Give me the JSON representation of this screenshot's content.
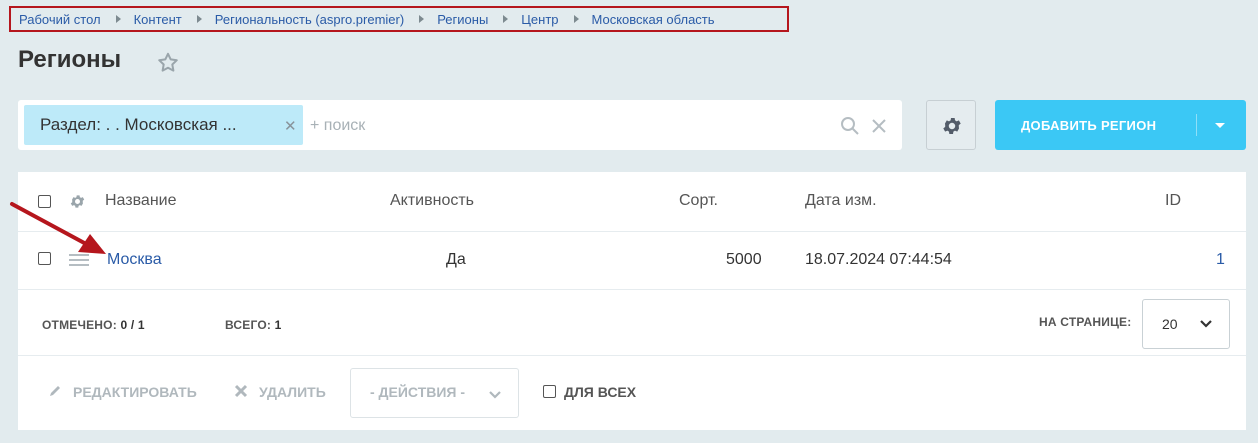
{
  "breadcrumb": [
    "Рабочий стол",
    "Контент",
    "Региональность (aspro.premier)",
    "Регионы",
    "Центр",
    "Московская область"
  ],
  "page": {
    "title": "Регионы"
  },
  "filter": {
    "chip_label": "Раздел: . . Московская ...",
    "search_placeholder": "+ поиск"
  },
  "toolbar": {
    "add_label": "ДОБАВИТЬ РЕГИОН"
  },
  "table": {
    "columns": [
      "Название",
      "Активность",
      "Сорт.",
      "Дата изм.",
      "ID"
    ],
    "rows": [
      {
        "name": "Москва",
        "active": "Да",
        "sort": "5000",
        "date": "18.07.2024 07:44:54",
        "id": "1"
      }
    ]
  },
  "footer": {
    "checked_label": "ОТМЕЧЕНО:",
    "checked_value": "0 / 1",
    "total_label": "ВСЕГО:",
    "total_value": "1",
    "per_page_label": "НА СТРАНИЦЕ:",
    "per_page_value": "20"
  },
  "actions": {
    "edit_label": "РЕДАКТИРОВАТЬ",
    "delete_label": "УДАЛИТЬ",
    "actions_select": "- ДЕЙСТВИЯ -",
    "for_all_label": "ДЛЯ ВСЕХ"
  },
  "colors": {
    "accent": "#3bc8f5",
    "chip": "#bdeaf9",
    "link": "#2a5ba7",
    "highlight": "#b5161d",
    "background": "#e2ebee"
  }
}
